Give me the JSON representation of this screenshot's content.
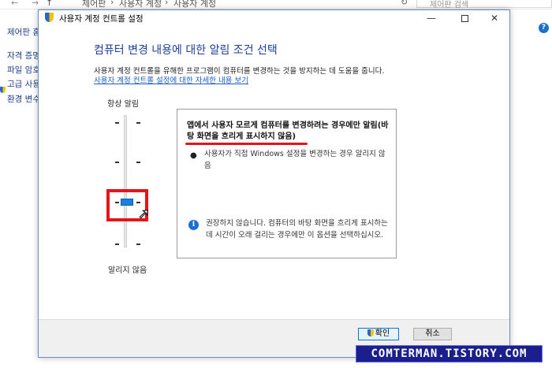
{
  "background_window": {
    "breadcrumb": [
      "제어판",
      "사용자 계정",
      "사용자 계정"
    ],
    "search_placeholder": "제어판 검색",
    "sidebar_links": [
      "제어판 홈",
      "자격 증명 관리",
      "파일 암호화",
      "고급 사용자",
      "환경 변수"
    ],
    "help_label": "?"
  },
  "dialog": {
    "title": "사용자 계정 컨트롤 설정",
    "minimize": "—",
    "close": "✕",
    "heading": "컴퓨터 변경 내용에 대한 알림 조건 선택",
    "description": "사용자 계정 컨트롤을 유해한 프로그램이 컴퓨터를 변경하는 것을 방지하는 데 도움을 줍니다.",
    "more_link": "사용자 계정 컨트롤 설정에 대한 자세한 내용 보기",
    "slider": {
      "top_label": "항상 알림",
      "bottom_label": "알리지 않음",
      "levels": 4,
      "selected_level": 2
    },
    "panel": {
      "title": "앱에서 사용자 모르게 컴퓨터를 변경하려는 경우에만 알림(바탕 화면을 흐리게 표시하지 않음)",
      "bullet": "사용자가 직접 Windows 설정을 변경하는 경우 알리지 않음",
      "info": "권장하지 않습니다. 컴퓨터의 바탕 화면을 흐리게 표시하는 데 시간이 오래 걸리는 경우에만 이 옵션을 선택하십시오."
    },
    "buttons": {
      "ok": "확인",
      "cancel": "취소"
    }
  },
  "watermark": "COMTERMAN.TISTORY.COM",
  "colors": {
    "heading": "#1f3f9a",
    "link": "#1a5fc6",
    "highlight": "#e3151a",
    "thumb": "#1a7fe0"
  }
}
